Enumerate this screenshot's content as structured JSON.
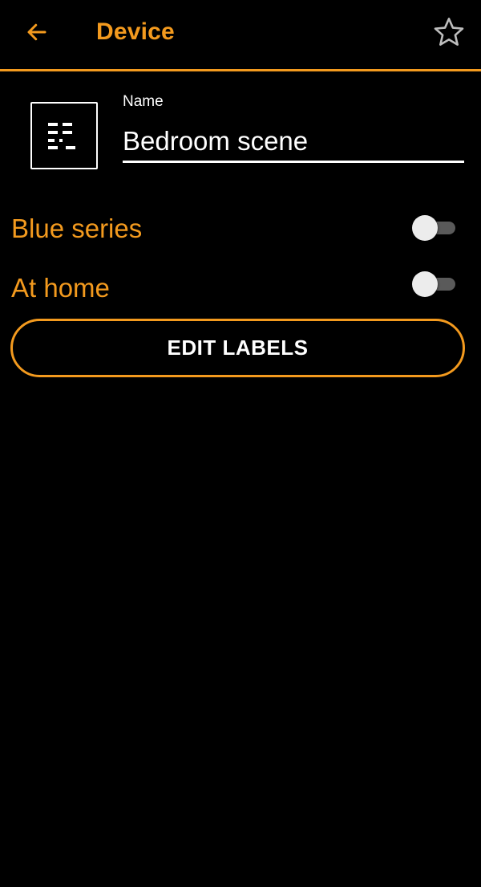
{
  "appbar": {
    "title": "Device",
    "back_icon": "arrow-left-icon",
    "favorite_icon": "star-outline-icon"
  },
  "device": {
    "icon": "list-scene-icon",
    "name_label": "Name",
    "name_value": "Bedroom scene"
  },
  "toggles": [
    {
      "label": "Blue series",
      "checked": false
    },
    {
      "label": "At home",
      "checked": false
    }
  ],
  "edit_labels_button": "EDIT LABELS",
  "colors": {
    "accent": "#F39A1E",
    "background": "#000000",
    "text": "#FFFFFF",
    "switch_track_off": "#5A5A5A",
    "switch_thumb_off": "#ECECEC"
  }
}
